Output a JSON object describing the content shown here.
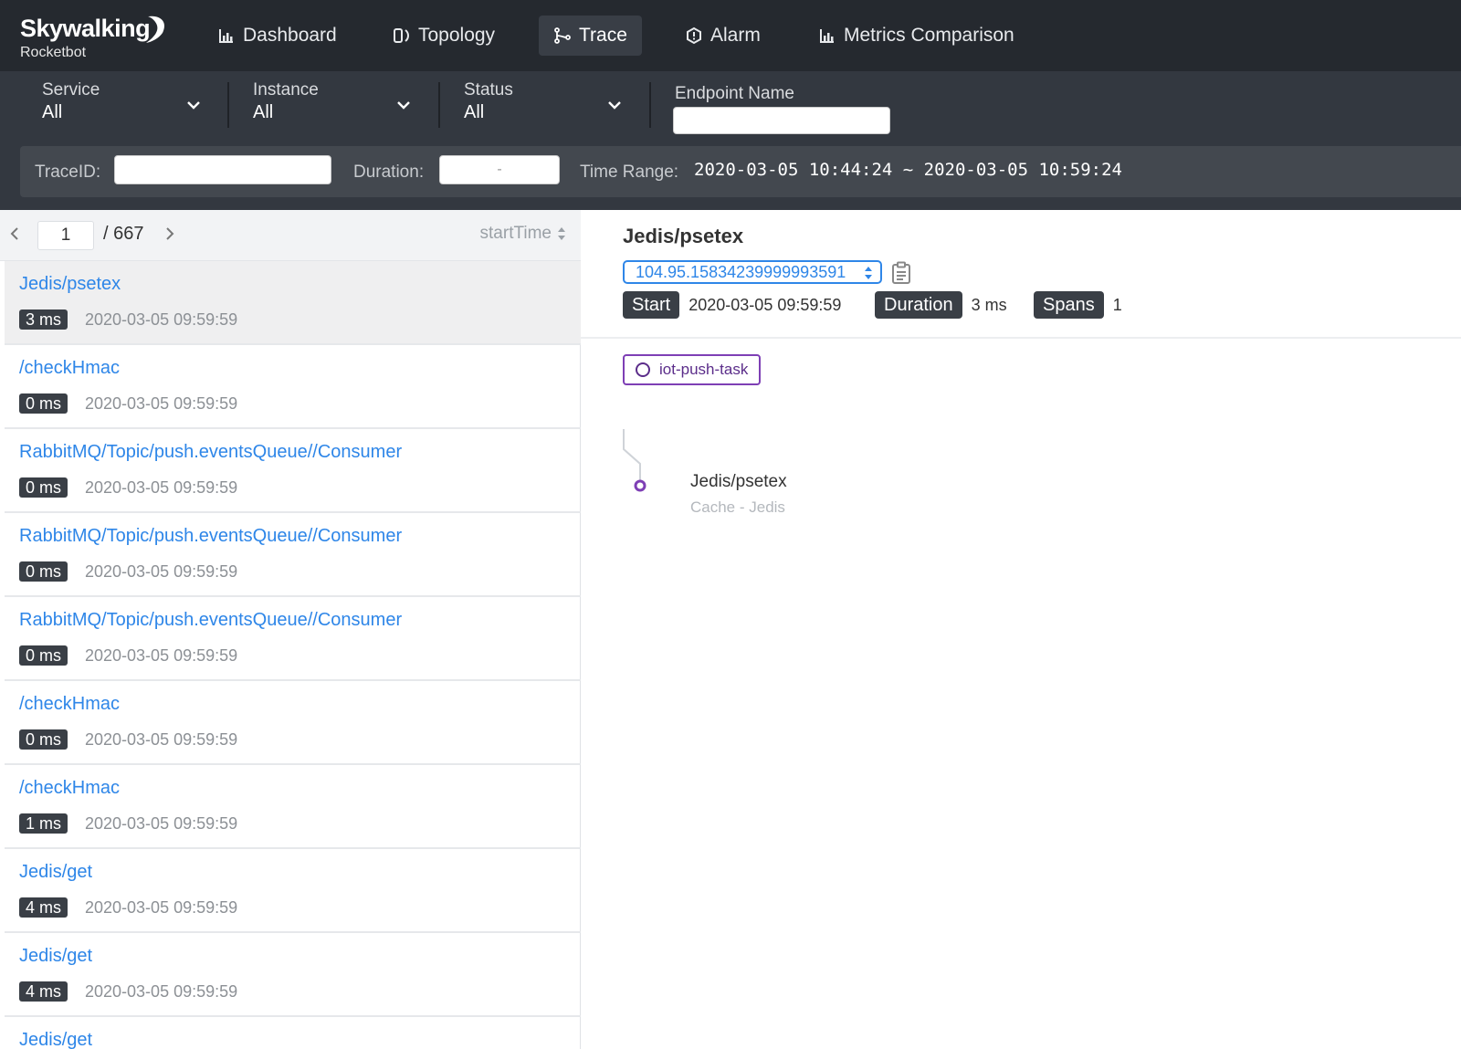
{
  "app": {
    "logo": "Skywalking",
    "sublogo": "Rocketbot"
  },
  "nav": [
    {
      "label": "Dashboard",
      "icon": "dashboard-icon",
      "active": false
    },
    {
      "label": "Topology",
      "icon": "topology-icon",
      "active": false
    },
    {
      "label": "Trace",
      "icon": "trace-icon",
      "active": true
    },
    {
      "label": "Alarm",
      "icon": "alarm-icon",
      "active": false
    },
    {
      "label": "Metrics Comparison",
      "icon": "metrics-icon",
      "active": false
    }
  ],
  "filters": {
    "service": {
      "label": "Service",
      "value": "All"
    },
    "instance": {
      "label": "Instance",
      "value": "All"
    },
    "status": {
      "label": "Status",
      "value": "All"
    },
    "endpoint": {
      "label": "Endpoint Name",
      "value": ""
    }
  },
  "search": {
    "traceid_label": "TraceID:",
    "traceid_value": "",
    "duration_label": "Duration:",
    "duration_value": "-",
    "timerange_label": "Time Range:",
    "timerange_value": "2020-03-05 10:44:24 ~ 2020-03-05 10:59:24"
  },
  "pager": {
    "current": "1",
    "total": "/ 667",
    "sort_label": "startTime"
  },
  "traces": [
    {
      "endpoint": "Jedis/psetex",
      "duration": "3 ms",
      "time": "2020-03-05 09:59:59"
    },
    {
      "endpoint": "/checkHmac",
      "duration": "0 ms",
      "time": "2020-03-05 09:59:59"
    },
    {
      "endpoint": "RabbitMQ/Topic/push.eventsQueue//Consumer",
      "duration": "0 ms",
      "time": "2020-03-05 09:59:59"
    },
    {
      "endpoint": "RabbitMQ/Topic/push.eventsQueue//Consumer",
      "duration": "0 ms",
      "time": "2020-03-05 09:59:59"
    },
    {
      "endpoint": "RabbitMQ/Topic/push.eventsQueue//Consumer",
      "duration": "0 ms",
      "time": "2020-03-05 09:59:59"
    },
    {
      "endpoint": "/checkHmac",
      "duration": "0 ms",
      "time": "2020-03-05 09:59:59"
    },
    {
      "endpoint": "/checkHmac",
      "duration": "1 ms",
      "time": "2020-03-05 09:59:59"
    },
    {
      "endpoint": "Jedis/get",
      "duration": "4 ms",
      "time": "2020-03-05 09:59:59"
    },
    {
      "endpoint": "Jedis/get",
      "duration": "4 ms",
      "time": "2020-03-05 09:59:59"
    },
    {
      "endpoint": "Jedis/get",
      "duration": "",
      "time": ""
    }
  ],
  "detail": {
    "title": "Jedis/psetex",
    "trace_id": "104.95.15834239999993591",
    "start_label": "Start",
    "start_value": "2020-03-05 09:59:59",
    "duration_label": "Duration",
    "duration_value": "3 ms",
    "spans_label": "Spans",
    "spans_value": "1",
    "service_tag": "iot-push-task",
    "span_name": "Jedis/psetex",
    "span_sub": "Cache - Jedis"
  },
  "colors": {
    "link": "#2e86e8",
    "service": "#7e3fb5",
    "topbar": "#25292f"
  }
}
